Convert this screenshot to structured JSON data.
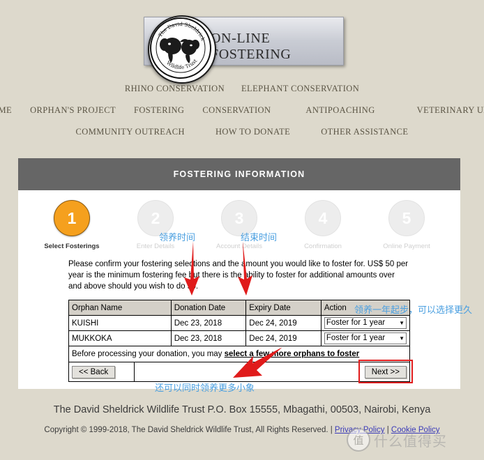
{
  "brand": {
    "banner_text": "ON-LINE FOSTERING",
    "seal_top_text": "The David Sheldrick",
    "seal_bottom_text": "Wildlife Trust"
  },
  "nav": {
    "row1": [
      "RHINO CONSERVATION",
      "ELEPHANT CONSERVATION"
    ],
    "row2": [
      "HOME",
      "ORPHAN'S PROJECT",
      "FOSTERING",
      "CONSERVATION",
      "ANTIPOACHING",
      "VETERINARY UNIT"
    ],
    "row3": [
      "COMMUNITY OUTREACH",
      "HOW TO DONATE",
      "OTHER ASSISTANCE"
    ]
  },
  "panel": {
    "title": "FOSTERING INFORMATION",
    "steps": [
      {
        "num": "1",
        "label": "Select Fosterings",
        "active": true
      },
      {
        "num": "2",
        "label": "Enter Details",
        "active": false
      },
      {
        "num": "3",
        "label": "Account Details",
        "active": false
      },
      {
        "num": "4",
        "label": "Confirmation",
        "active": false
      },
      {
        "num": "5",
        "label": "Online Payment",
        "active": false
      }
    ],
    "intro": "Please confirm your fostering selections and the amount you would like to foster for. US$ 50 per year is the minimum fostering fee but there is the ability to foster for additional amounts over and above should you wish to do so.",
    "table": {
      "headers": [
        "Orphan Name",
        "Donation Date",
        "Expiry Date",
        "Action"
      ],
      "rows": [
        {
          "name": "KUISHI",
          "donation_date": "Dec 23, 2018",
          "expiry_date": "Dec 24, 2019",
          "action": "Foster for 1 year"
        },
        {
          "name": "MUKKOKA",
          "donation_date": "Dec 23, 2018",
          "expiry_date": "Dec 24, 2019",
          "action": "Foster for 1 year"
        }
      ]
    },
    "note_prefix": "Before processing your donation, you may ",
    "note_link": "select a few more orphans to foster",
    "back_button": "<< Back",
    "next_button": "Next >>"
  },
  "footer": {
    "address": "The David Sheldrick Wildlife Trust P.O. Box 15555, Mbagathi, 00503, Nairobi, Kenya",
    "copyright": "Copyright © 1999-2018, The David Sheldrick Wildlife Trust, All Rights Reserved. | ",
    "privacy_link": "Privacy Policy",
    "separator": " | ",
    "cookie_link": "Cookie Policy"
  },
  "annotations": {
    "adoption_time": "领养时间",
    "end_time": "结束时间",
    "year_note": "领养一年起步，可以选择更久",
    "more_note": "还可以同时领养更多小象"
  },
  "watermark": {
    "badge": "值",
    "text": "什么值得买"
  },
  "colors": {
    "page_bg": "#ddd9cc",
    "panel_header": "#666666",
    "active_step": "#F5A01E",
    "annotation": "#4a9fe0",
    "highlight": "#e01b1b",
    "link": "#3a3ab8"
  }
}
